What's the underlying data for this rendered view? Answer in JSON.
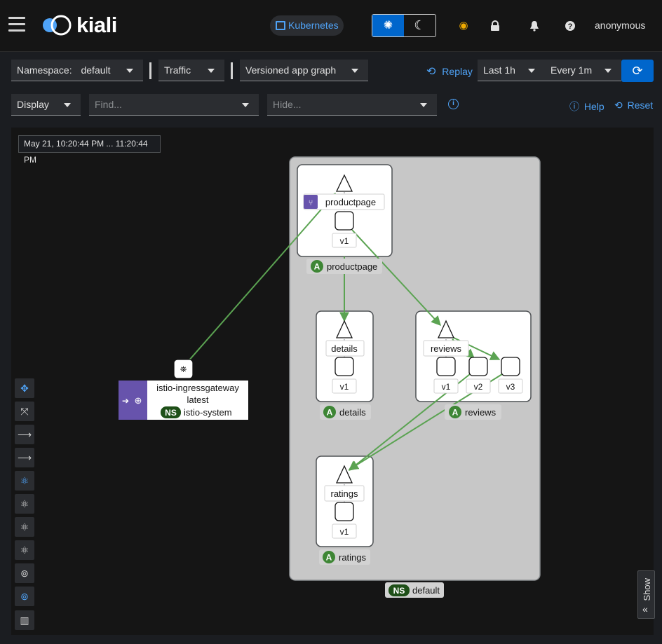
{
  "masthead": {
    "logo": "kiali",
    "cluster": "Kubernetes",
    "user": "anonymous"
  },
  "toolbar": {
    "namespace_label": "Namespace:",
    "namespace_value": "default",
    "traffic": "Traffic",
    "graph_type": "Versioned app graph",
    "replay": "Replay",
    "duration": "Last 1h",
    "refresh_interval": "Every 1m",
    "display": "Display",
    "find_placeholder": "Find...",
    "hide_placeholder": "Hide...",
    "help": "Help",
    "reset": "Reset"
  },
  "graph": {
    "time_range": "May 21, 10:20:44 PM ... 11:20:44 PM",
    "namespace_box": {
      "badge": "NS",
      "name": "default"
    },
    "ingress": {
      "name": "istio-ingressgateway",
      "version": "latest",
      "ns_badge": "NS",
      "namespace": "istio-system"
    },
    "apps": [
      {
        "badge": "A",
        "name": "productpage",
        "service": "productpage",
        "versions": [
          "v1"
        ]
      },
      {
        "badge": "A",
        "name": "details",
        "service": "details",
        "versions": [
          "v1"
        ]
      },
      {
        "badge": "A",
        "name": "reviews",
        "service": "reviews",
        "versions": [
          "v1",
          "v2",
          "v3"
        ]
      },
      {
        "badge": "A",
        "name": "ratings",
        "service": "ratings",
        "versions": [
          "v1"
        ]
      }
    ],
    "show_legend": "Show"
  },
  "colors": {
    "accent": "#0066cc",
    "link": "#4fa3f7",
    "edge": "#5ba352",
    "app_badge": "#3e8635",
    "ns_badge": "#1e4f18",
    "virtual_service": "#6753ac"
  }
}
